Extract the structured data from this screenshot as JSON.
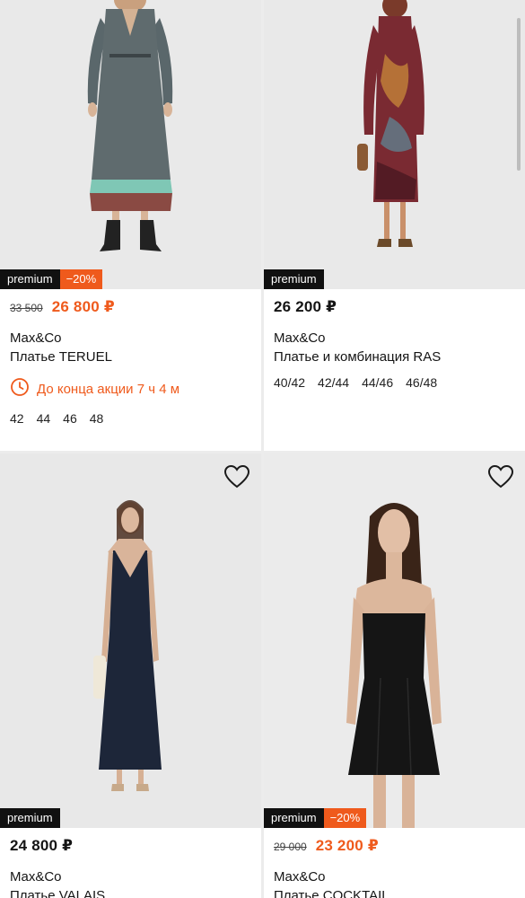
{
  "products": [
    {
      "badge_premium": "premium",
      "badge_discount": "−20%",
      "old_price": "33 500",
      "price": "26 800 ₽",
      "brand": "Max&Co",
      "name": "Платье TERUEL",
      "timer_text": "До конца акции 7 ч 4 м",
      "sizes": [
        "42",
        "44",
        "46",
        "48"
      ],
      "image_icon": "dress-photo",
      "colors": {
        "dress": "#5f6b6e",
        "hem": "#7fc7b5"
      }
    },
    {
      "badge_premium": "premium",
      "price": "26 200 ₽",
      "brand": "Max&Co",
      "name": "Платье и комбинация RAS",
      "sizes": [
        "40/42",
        "42/44",
        "44/46",
        "46/48"
      ],
      "image_icon": "dress-photo",
      "colors": {
        "dress": "#7a2a32"
      }
    },
    {
      "badge_premium": "premium",
      "price": "24 800 ₽",
      "brand": "Max&Co",
      "name": "Платье VALAIS",
      "image_icon": "dress-photo",
      "favorite_icon": "heart-icon",
      "colors": {
        "dress": "#1d2639"
      }
    },
    {
      "badge_premium": "premium",
      "badge_discount": "−20%",
      "old_price": "29 000",
      "price": "23 200 ₽",
      "brand": "Max&Co",
      "name": "Платье COCKTAIL",
      "image_icon": "dress-photo",
      "favorite_icon": "heart-icon",
      "colors": {
        "dress": "#151515"
      }
    }
  ],
  "colors": {
    "accent": "#ef5a1c",
    "badge_dark": "#111111",
    "photo_bg": "#e9e9e9"
  }
}
